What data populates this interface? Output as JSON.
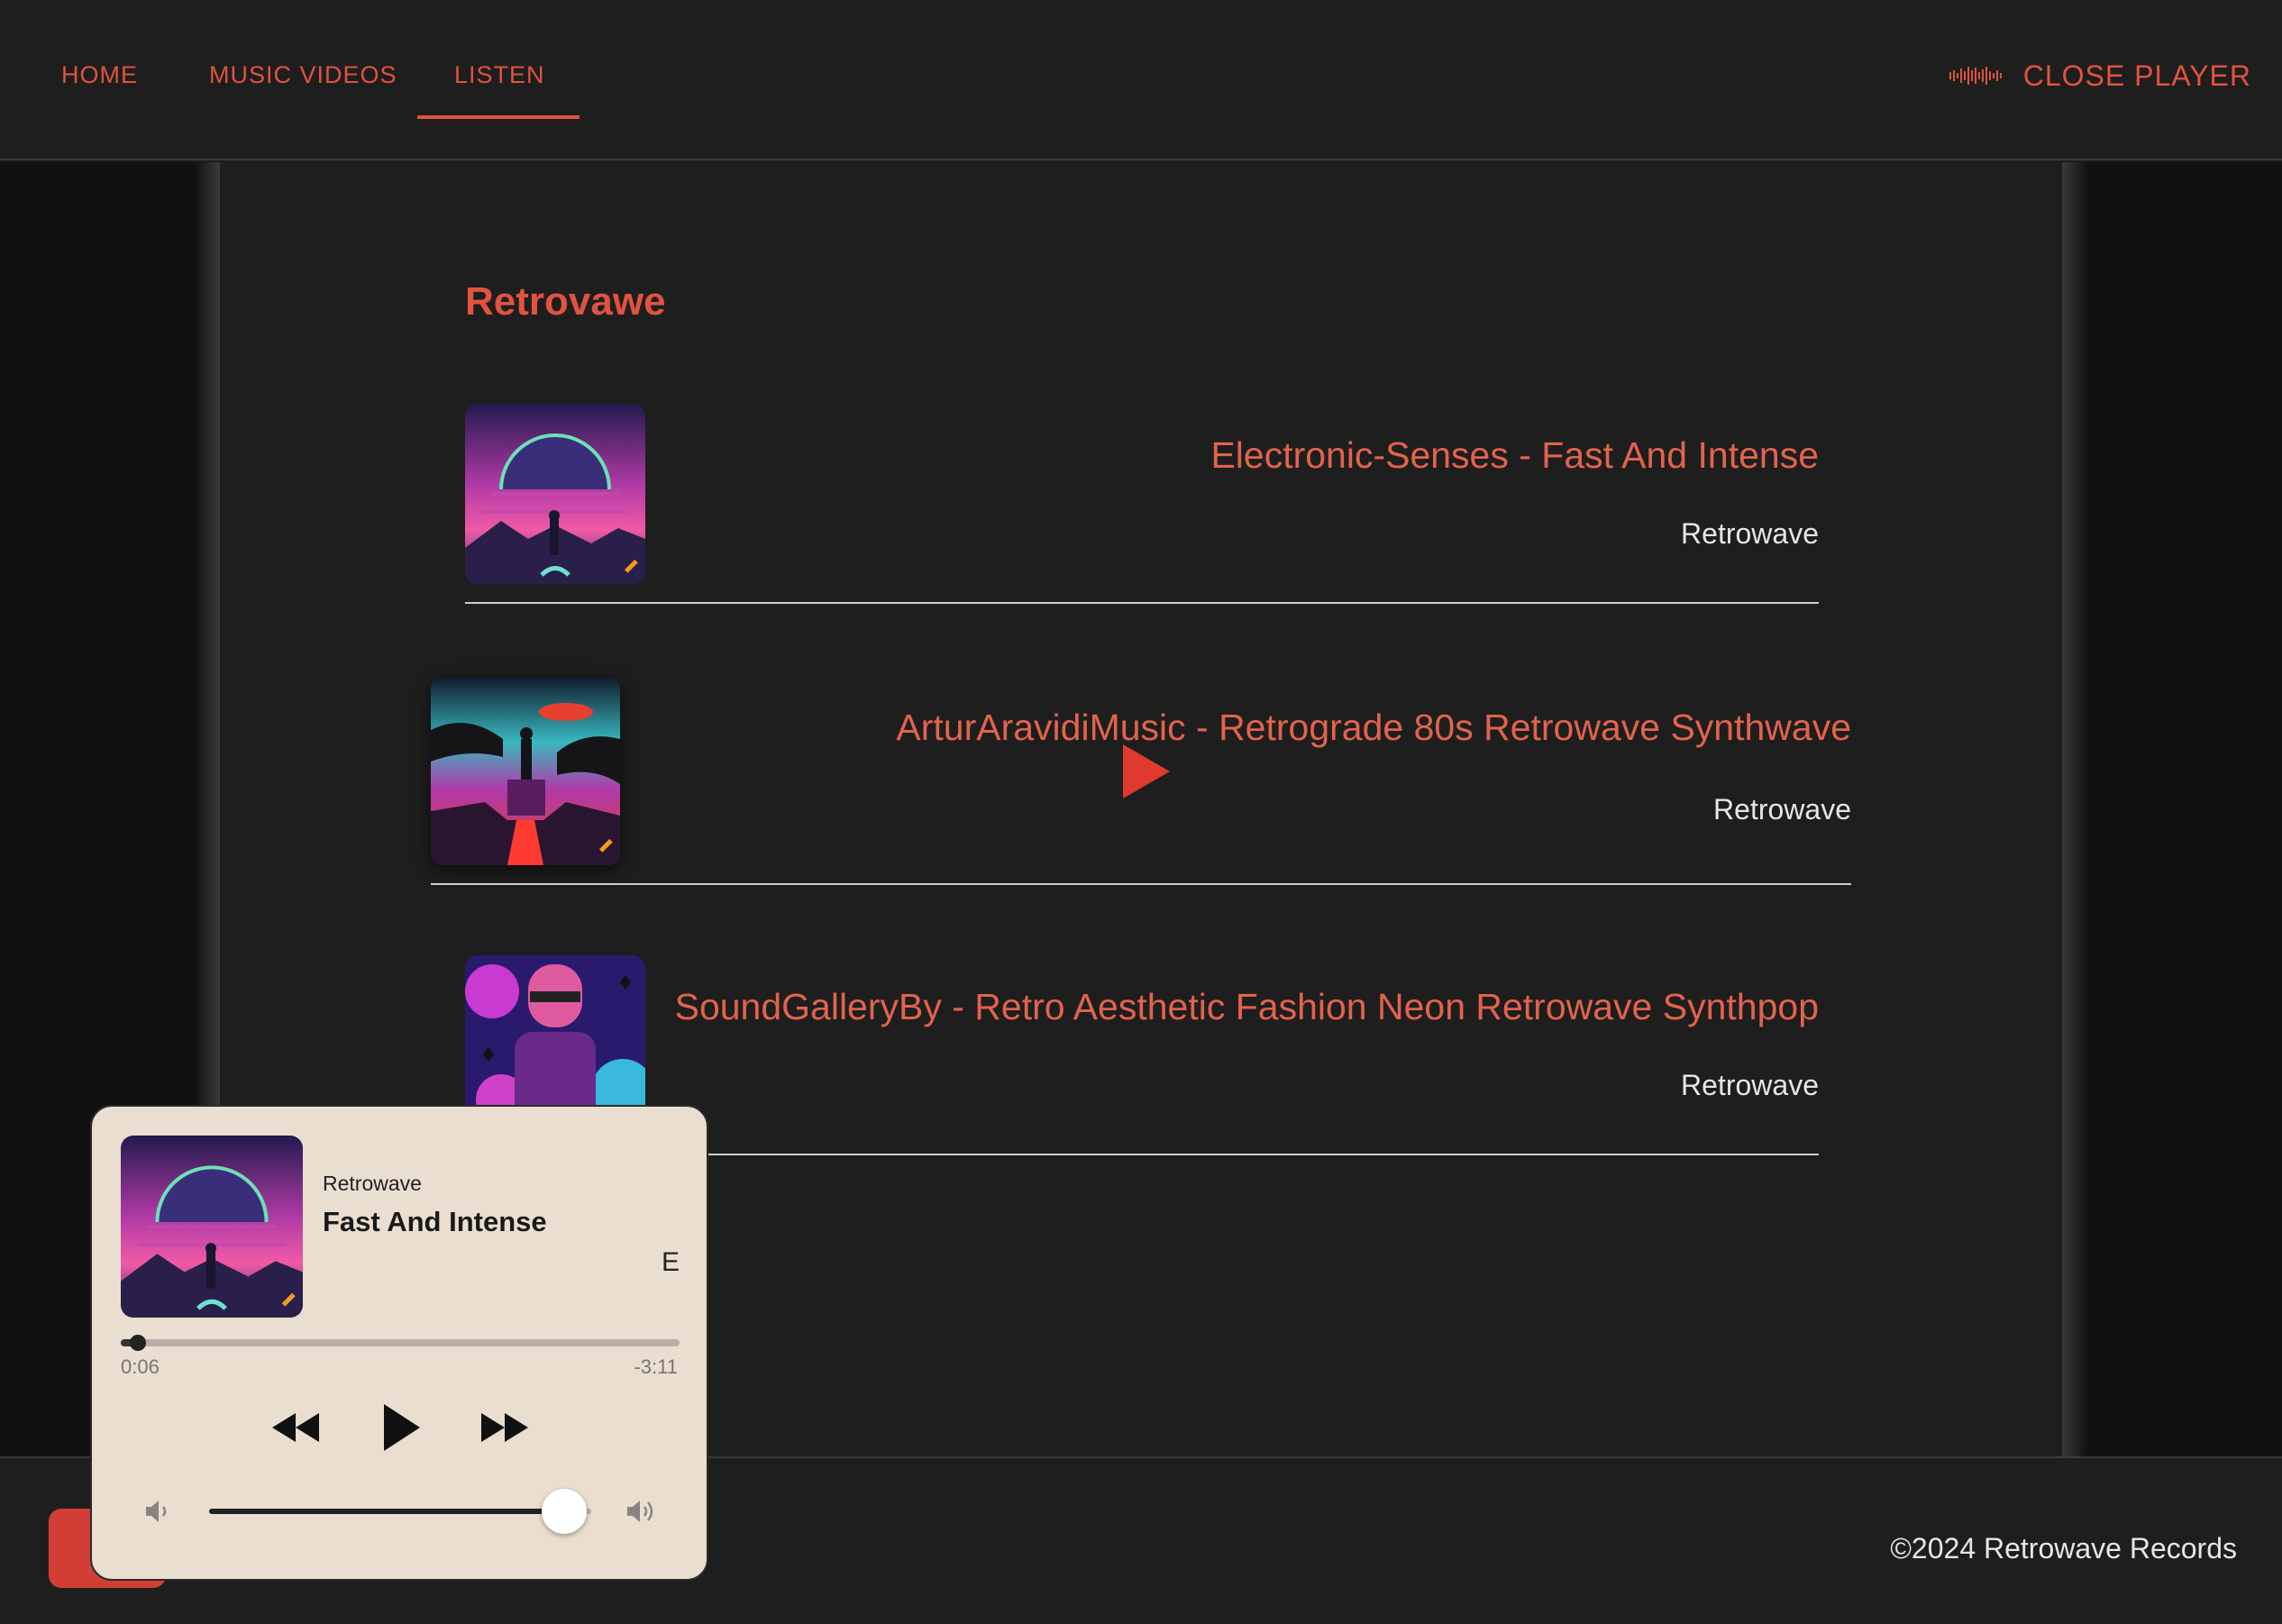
{
  "nav": {
    "items": [
      {
        "label": "HOME"
      },
      {
        "label": "MUSIC VIDEOS"
      },
      {
        "label": "LISTEN"
      }
    ],
    "active": "LISTEN",
    "close_player": "CLOSE PLAYER"
  },
  "playlist": {
    "title": "Retrovawe",
    "tracks": [
      {
        "title": "Electronic-Senses - Fast And Intense",
        "artist": "Retrowave"
      },
      {
        "title": "ArturAravidiMusic - Retrograde 80s Retrowave Synthwave",
        "artist": "Retrowave"
      },
      {
        "title": "SoundGalleryBy - Retro Aesthetic Fashion Neon Retrowave Synthpop",
        "artist": "Retrowave"
      }
    ]
  },
  "player": {
    "artist": "Retrowave",
    "title": "Fast And Intense",
    "explicit": "E",
    "elapsed": "0:06",
    "remaining": "-3:11",
    "progress_fraction": 0.03,
    "volume_fraction": 0.93
  },
  "footer": {
    "copyright": "©2024 Retrowave Records"
  },
  "colors": {
    "accent": "#e0533f",
    "background": "#1e1e1e",
    "player_bg": "#eaded0"
  }
}
